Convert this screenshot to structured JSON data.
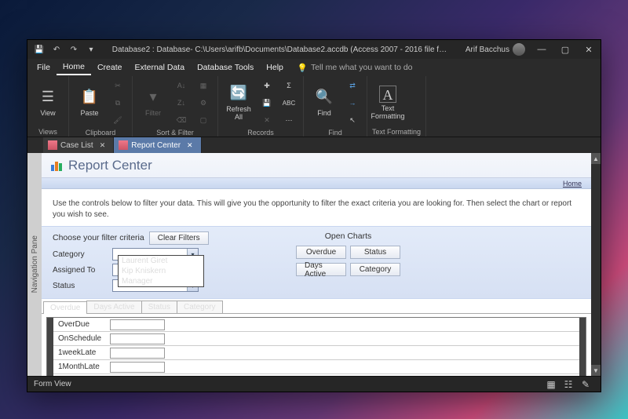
{
  "window": {
    "title": "Database2 : Database- C:\\Users\\arifb\\Documents\\Database2.accdb (Access 2007 - 2016 file f…",
    "user": "Arif Bacchus"
  },
  "menus": [
    "File",
    "Home",
    "Create",
    "External Data",
    "Database Tools",
    "Help"
  ],
  "tellme": "Tell me what you want to do",
  "ribbon": {
    "groups": {
      "views": {
        "label": "Views",
        "view": "View"
      },
      "clipboard": {
        "label": "Clipboard",
        "paste": "Paste"
      },
      "sortfilter": {
        "label": "Sort & Filter",
        "filter": "Filter"
      },
      "records": {
        "label": "Records",
        "refresh": "Refresh All"
      },
      "find": {
        "label": "Find",
        "find": "Find"
      },
      "textfmt": {
        "label": "Text Formatting",
        "text": "Text Formatting"
      }
    }
  },
  "tabs": [
    {
      "label": "Case List",
      "active": false
    },
    {
      "label": "Report Center",
      "active": true
    }
  ],
  "navpane_label": "Navigation Pane",
  "form": {
    "title": "Report Center",
    "home_link": "Home",
    "instruction": "Use the controls below to filter your data. This will give you the opportunity to filter the exact criteria you are looking for. Then select the chart or report you wish to see.",
    "criteria_label": "Choose your filter criteria",
    "clear_filters": "Clear Filters",
    "fields": {
      "category": "Category",
      "assigned_to": "Assigned To",
      "status": "Status"
    },
    "assigned_options": [
      "Laurent Giret",
      "Kip Kniskern",
      "Manager"
    ],
    "open_charts_label": "Open Charts",
    "chart_buttons": [
      "Overdue",
      "Status",
      "Days Active",
      "Category"
    ],
    "report_tabs": [
      "Overdue",
      "Days Active",
      "Status",
      "Category"
    ],
    "grid_rows": [
      "OverDue",
      "OnSchedule",
      "1weekLate",
      "1MonthLate"
    ]
  },
  "statusbar": {
    "mode": "Form View"
  }
}
